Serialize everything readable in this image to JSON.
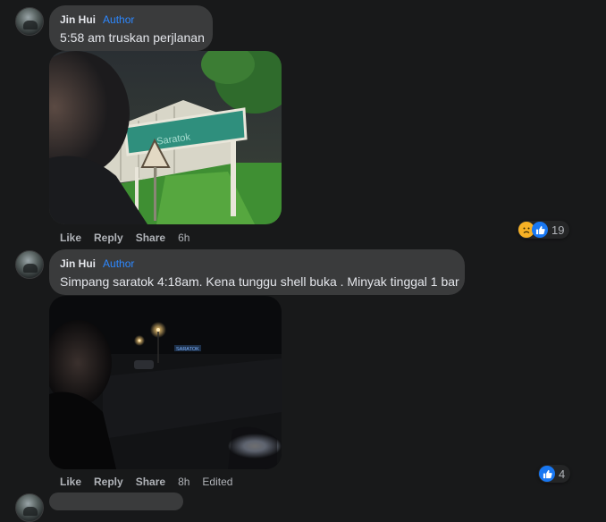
{
  "comments": [
    {
      "author": "Jin Hui",
      "badge": "Author",
      "text": "5:58 am truskan perjlanan",
      "photo_sign_text": "Saratok",
      "actions": {
        "like": "Like",
        "reply": "Reply",
        "share": "Share",
        "time": "6h",
        "edited": ""
      },
      "reaction_count": "19",
      "reaction_icons": [
        "sad-icon",
        "like-icon"
      ]
    },
    {
      "author": "Jin Hui",
      "badge": "Author",
      "text": "Simpang saratok 4:18am. Kena tunggu shell buka . Minyak tinggal 1 bar",
      "photo_sign_text": "SARATOK",
      "actions": {
        "like": "Like",
        "reply": "Reply",
        "share": "Share",
        "time": "8h",
        "edited": "Edited"
      },
      "reaction_count": "4",
      "reaction_icons": [
        "like-icon"
      ]
    }
  ],
  "colors": {
    "background": "#18191a",
    "bubble": "#3a3b3c",
    "author_badge": "#2d88ff",
    "like_blue": "#1877f2",
    "sad_yellow": "#f7b125"
  }
}
